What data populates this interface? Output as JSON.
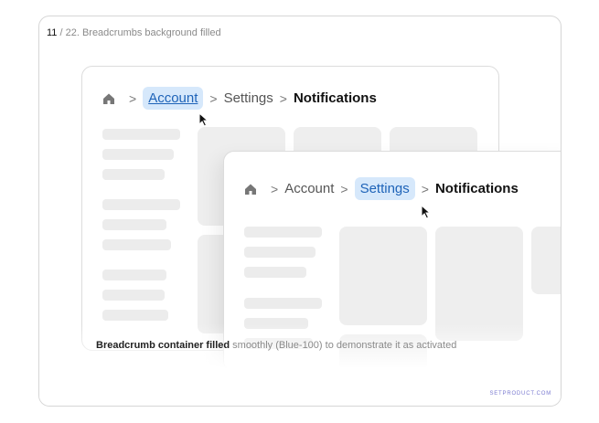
{
  "slide": {
    "number": "11",
    "total_title": " / 22. Breadcrumbs background filled"
  },
  "window1": {
    "crumbs": {
      "home_icon": "home-icon",
      "item1": "Account",
      "item2": "Settings",
      "current": "Notifications"
    },
    "separator": ">"
  },
  "window2": {
    "crumbs": {
      "home_icon": "home-icon",
      "item1": "Account",
      "item2": "Settings",
      "current": "Notifications"
    },
    "separator": ">"
  },
  "caption": {
    "bold": "Breadcrumb container filled",
    "rest": " smoothly (Blue-100) to demonstrate it as activated"
  },
  "brand": "SETPRODUCT.COM",
  "colors": {
    "active_bg": "#d6e8fb",
    "active_text": "#1e63b8",
    "skeleton": "#ececec"
  }
}
